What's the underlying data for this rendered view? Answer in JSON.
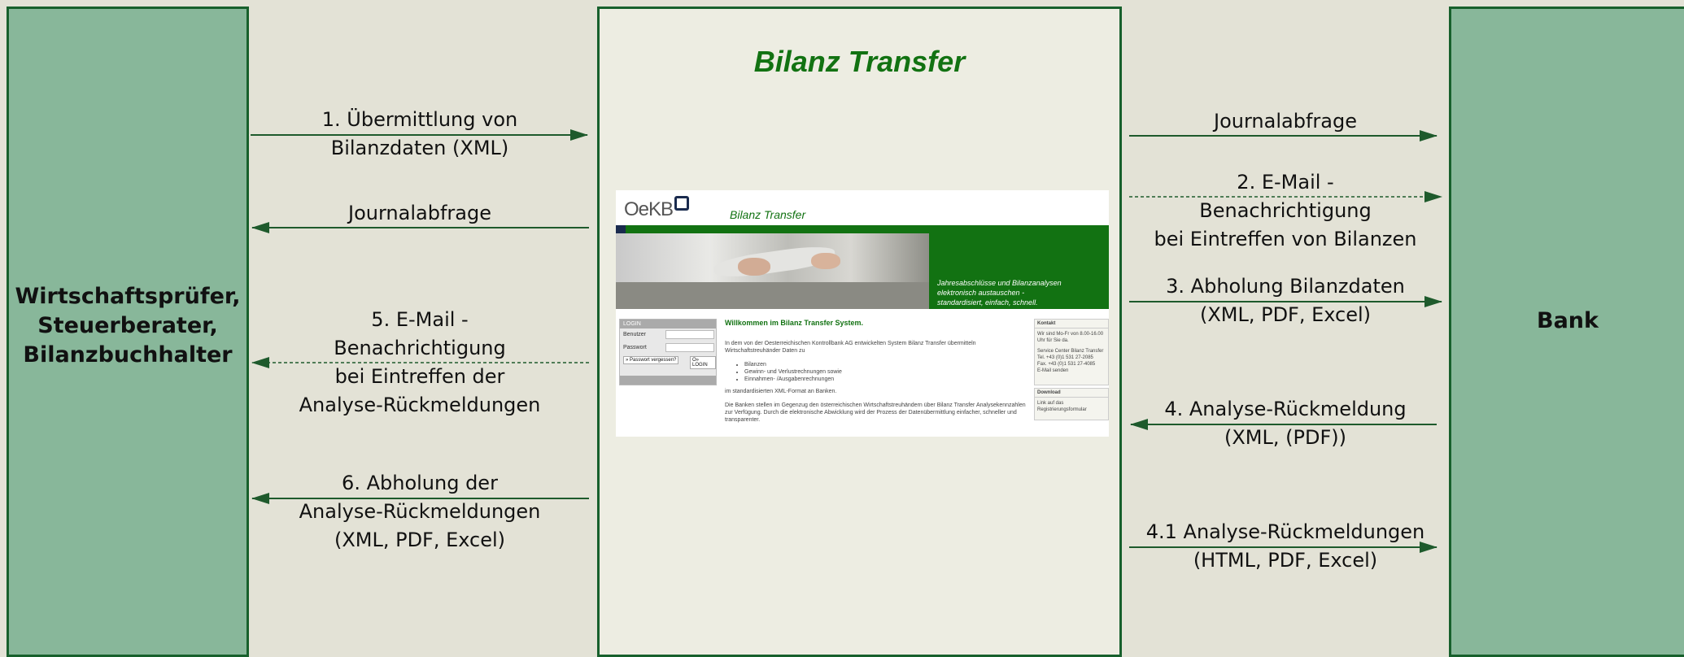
{
  "left_actor": {
    "lines": [
      "Wirtschaftsprüfer,",
      "Steuerberater,",
      "Bilanzbuchhalter"
    ]
  },
  "right_actor": {
    "label": "Bank"
  },
  "center": {
    "title": "Bilanz Transfer",
    "screenshot": {
      "logo": "OeKB",
      "app_title": "Bilanz Transfer",
      "slogan_lines": [
        "Jahresabschlüsse und Bilanzanalysen",
        "elektronisch austauschen -",
        "standardisiert, einfach, schnell."
      ],
      "login": {
        "header": "LOGIN",
        "user_label": "Benutzer",
        "password_label": "Passwort",
        "forgot_button": "» Passwort vergessen?",
        "login_button": "O» LOGIN"
      },
      "welcome": "Willkommen im Bilanz Transfer System.",
      "intro": "In dem von der Oesterreichischen Kontrollbank AG entwickelten System Bilanz Transfer übermitteln Wirtschaftstreuhänder Daten zu",
      "list": [
        "Bilanzen",
        "Gewinn- und Verlustrechnungen sowie",
        "Einnahmen- /Ausgabenrechnungen"
      ],
      "format_text": "im standardisierten XML-Format an Banken.",
      "closing": "Die Banken stellen im Gegenzug den österreichischen Wirtschaftstreuhändern über Bilanz Transfer Analysekennzahlen zur Verfügung. Durch die elektronische Abwicklung wird der Prozess der Datenübermittlung einfacher, schneller und transparenter.",
      "kontakt": {
        "header": "Kontakt",
        "hours": "Wir sind Mo-Fr von 8.00-16.00 Uhr für Sie da.",
        "lines": [
          "Service Center Bilanz Transfer",
          "Tel. +43 (0)1 531 27-2085",
          "Fax. +43 (0)1 531 27-4085",
          "E-Mail senden"
        ]
      },
      "download": {
        "header": "Download",
        "lines": [
          "Link auf das",
          "Registrierungsformular"
        ]
      }
    }
  },
  "flows_left": [
    {
      "lines": [
        "1. Übermittlung von",
        "Bilanzdaten (XML)"
      ],
      "direction": "to-center",
      "style": "solid"
    },
    {
      "lines": [
        "Journalabfrage"
      ],
      "direction": "to-left",
      "style": "solid"
    },
    {
      "lines": [
        "5. E-Mail -",
        "Benachrichtigung",
        "bei Eintreffen der",
        "Analyse-Rückmeldungen"
      ],
      "direction": "to-left",
      "style": "dashed"
    },
    {
      "lines": [
        "6. Abholung der",
        "Analyse-Rückmeldungen",
        "(XML, PDF, Excel)"
      ],
      "direction": "to-left",
      "style": "solid"
    }
  ],
  "flows_right": [
    {
      "lines": [
        "Journalabfrage"
      ],
      "direction": "to-right",
      "style": "solid"
    },
    {
      "lines": [
        "2. E-Mail -",
        "Benachrichtigung",
        "bei Eintreffen von Bilanzen"
      ],
      "direction": "to-right",
      "style": "dashed"
    },
    {
      "lines": [
        "3. Abholung Bilanzdaten",
        "(XML, PDF, Excel)"
      ],
      "direction": "to-right",
      "style": "solid"
    },
    {
      "lines": [
        "4. Analyse-Rückmeldung",
        "(XML, (PDF))"
      ],
      "direction": "to-center",
      "style": "solid"
    },
    {
      "lines": [
        "4.1 Analyse-Rückmeldungen",
        "(HTML, PDF, Excel)"
      ],
      "direction": "to-right",
      "style": "solid"
    }
  ],
  "colors": {
    "border": "#17602c",
    "panel_fill": "#88b79a",
    "background": "#e3e2d6",
    "center_fill": "#edede2",
    "arrow": "#1e5a2c",
    "title": "#127212"
  }
}
